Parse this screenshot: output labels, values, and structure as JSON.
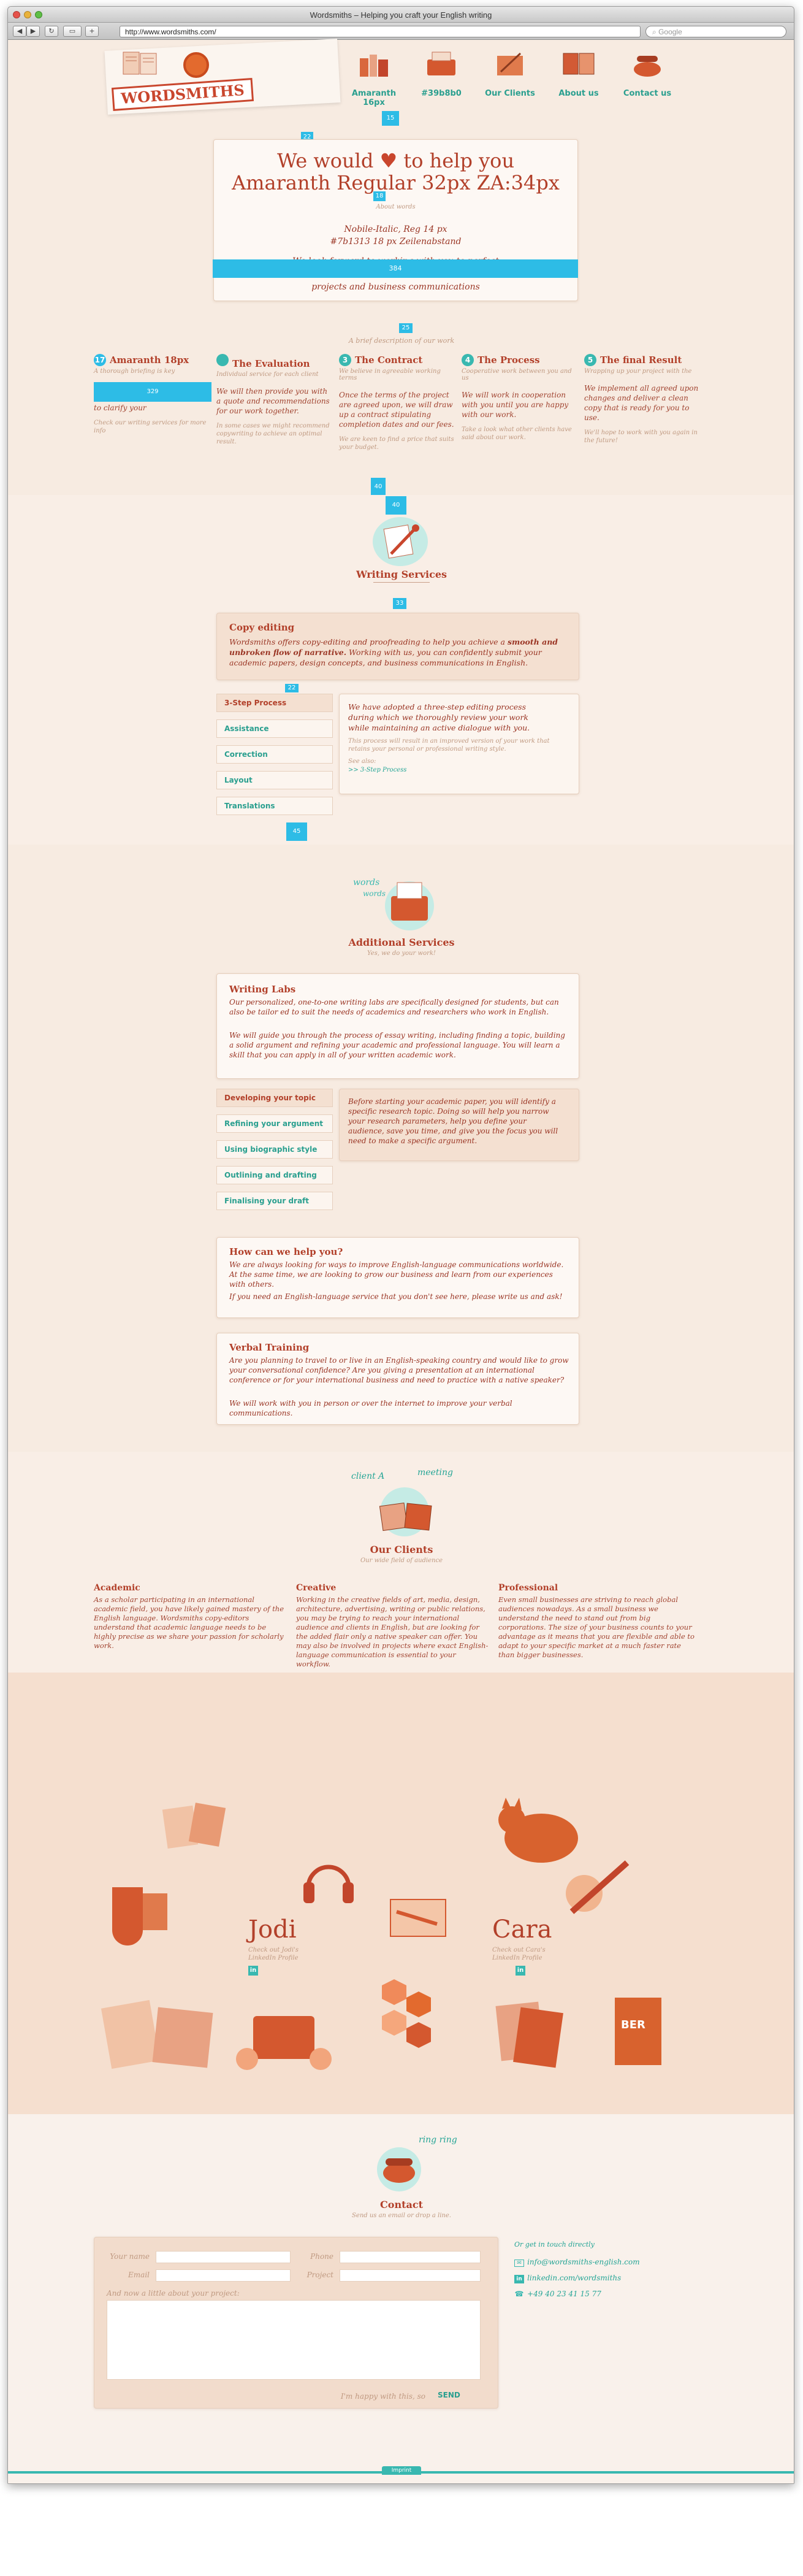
{
  "browser": {
    "window_title": "Wordsmiths – Helping you craft your English writing",
    "url": "http://www.wordsmiths.com/",
    "search_placeholder": "Google"
  },
  "header": {
    "logo_text": "WORDSMITHS",
    "nav": [
      {
        "label": "Amaranth 16px",
        "icon": "books-icon"
      },
      {
        "label": "#39b8b0",
        "icon": "typewriter-icon"
      },
      {
        "label": "Our Clients",
        "icon": "quill-icon"
      },
      {
        "label": "About us",
        "icon": "portrait-icon"
      },
      {
        "label": "Contact us",
        "icon": "telephone-icon"
      }
    ],
    "marker_top": "15"
  },
  "intro": {
    "heading_line1_a": "We would",
    "heading_line1_b": "to help you",
    "heading_line2": "Amaranth Regular 32px ZA:34px",
    "small_label": "About words",
    "font_line1": "Nobile-Italic, Reg 14 px",
    "font_line2": "#7b1313 18 px Zeilenabstand",
    "body_partial": "We look forward to working with you to perfect",
    "body_partial2": "projects and business communications",
    "bar_label": "384",
    "caption": "A brief description of our work",
    "marker_a": "22",
    "marker_b": "25",
    "marker_c": "18"
  },
  "steps": [
    {
      "num": "17",
      "title": "Amaranth 18px",
      "sub": "A thorough briefing is key",
      "text": "to clarify your",
      "foot": "Check our writing services for more info",
      "overlay": "329"
    },
    {
      "num": "",
      "title": "The Evaluation",
      "sub": "Individual service for each client",
      "text": "We will then provide you with a quote and recommendations for our work together.",
      "foot": "In some cases we might recommend copywriting to achieve an optimal result."
    },
    {
      "num": "3",
      "title": "The Contract",
      "sub": "We believe in agreeable working terms",
      "text": "Once the terms of the project are agreed upon, we will draw up a contract stipulating completion dates and our fees.",
      "foot": "We are keen to find a price that suits your budget."
    },
    {
      "num": "4",
      "title": "The Process",
      "sub": "Cooperative work between you and us",
      "text": "We will work in cooperation with you until you are happy with our work.",
      "foot": "Take a look what other clients have said about our work."
    },
    {
      "num": "5",
      "title": "The final Result",
      "sub": "Wrapping up your project with the",
      "text": "We implement all agreed upon changes and deliver a clean copy that is ready for you to use.",
      "foot": "We'll hope to work with you again in the future!"
    }
  ],
  "steps_markers": [
    "40",
    "40"
  ],
  "writing": {
    "title": "Writing Services",
    "marker_top": "33",
    "marker_mid": "22",
    "marker_bottom": "45",
    "copy_title": "Copy editing",
    "copy_text_a": "Wordsmiths offers copy-editing and proofreading to help you achieve a",
    "copy_text_bold": "smooth and unbroken flow of narrative.",
    "copy_text_b": "Working with us, you can confidently submit your academic papers, design concepts, and business communications in English.",
    "tabs": [
      "3-Step Process",
      "Assistance",
      "Correction",
      "Layout",
      "Translations"
    ],
    "tab_text": "We have adopted a three-step editing process during which we thoroughly review your work while maintaining an active dialogue with you.",
    "tab_small": "This process will result in an improved version of your work that retains your personal or professional writing style.",
    "see_also": "See also:",
    "see_link": ">> 3-Step Process"
  },
  "additional": {
    "title": "Additional Services",
    "subtitle": "Yes, we do your work!",
    "labs_title": "Writing Labs",
    "labs_p1": "Our personalized, one-to-one writing labs are specifically designed for students, but can also be tailor ed to suit the needs of academics and researchers who work in English.",
    "labs_p2": "We will guide you through the process of essay writing, including finding a topic, building a solid argument and refining your academic and professional language. You will learn a skill that you can apply in all of your written academic work.",
    "tabs": [
      "Developing your topic",
      "Refining your argument",
      "Using biographic style",
      "Outlining and drafting",
      "Finalising your draft"
    ],
    "tab_text": "Before starting your academic paper, you will identify a specific research topic. Doing so will help you narrow your research parameters, help you define your audience, save you time, and give you the focus you will need to make a specific argument.",
    "help_title": "How can we help you?",
    "help_p1": "We are always looking for ways to improve English-language communications worldwide. At the same time, we are looking to grow our business and learn from our experiences with others.",
    "help_p2": "If you need an English-language service that you don't see here, please write us and ask!",
    "verbal_title": "Verbal Training",
    "verbal_p1": "Are you planning to travel to or live in an English-speaking country and would like to grow your conversational confidence? Are you giving a presentation at an international conference or for your international business and need to practice with a native speaker?",
    "verbal_p2": "We will work with you in person or over the internet to improve your verbal communications."
  },
  "clients": {
    "title": "Our Clients",
    "subtitle": "Our wide field of audience",
    "hand_a": "client A",
    "hand_b": "meeting",
    "cols": [
      {
        "title": "Academic",
        "text": "As a scholar participating in an international academic field, you have likely gained mastery of the English language. Wordsmiths copy-editors understand that academic language needs to be highly precise as we share your passion for scholarly work."
      },
      {
        "title": "Creative",
        "text": "Working in the creative fields of art, media, design, architecture, advertising, writing or public relations, you may be trying to reach your international audience and clients in English, but are looking for the added flair only a native speaker can offer. You may also be involved in projects where exact English-language communication is essential to your workflow."
      },
      {
        "title": "Professional",
        "text": "Even small businesses are striving to reach global audiences nowadays. As a small business we understand the need to stand out from big corporations. The size of your business counts to your advantage as it means that you are flexible and able to adapt to your specific market at a much faster rate than bigger businesses."
      }
    ]
  },
  "about": {
    "person1": "Jodi",
    "person1_link": "Check out Jodi's LinkedIn Profile",
    "person2": "Cara",
    "person2_link": "Check out Cara's LinkedIn Profile",
    "linkedin": "in"
  },
  "contact": {
    "title": "Contact",
    "subtitle": "Send us an email or drop a line.",
    "hand": "ring ring",
    "labels": {
      "name": "Your name",
      "phone": "Phone",
      "email": "Email",
      "project": "Project",
      "message": "And now a little about your project:"
    },
    "happy": "I'm happy with this, so",
    "send": "SEND",
    "direct_title": "Or get in touch directly",
    "email": "info@wordsmiths-english.com",
    "linkedin": "linkedin.com/wordsmiths",
    "phone": "+49 40 23 41 15 77"
  },
  "footer": {
    "label": "Imprint"
  },
  "colors": {
    "accent": "#b2402a",
    "teal": "#39b8b0",
    "marker": "#2dbce6",
    "page": "#f7ebe1"
  }
}
